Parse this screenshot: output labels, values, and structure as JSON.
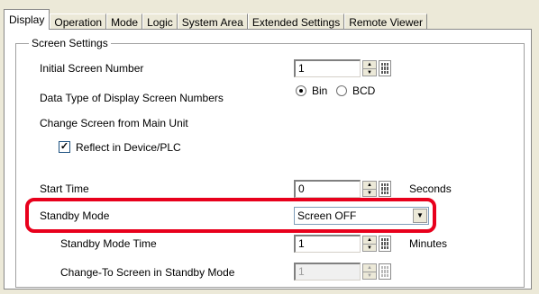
{
  "tabs": [
    {
      "label": "Display",
      "active": true
    },
    {
      "label": "Operation",
      "active": false
    },
    {
      "label": "Mode",
      "active": false
    },
    {
      "label": "Logic",
      "active": false
    },
    {
      "label": "System Area",
      "active": false
    },
    {
      "label": "Extended Settings",
      "active": false
    },
    {
      "label": "Remote Viewer",
      "active": false
    }
  ],
  "group": {
    "title": "Screen Settings"
  },
  "initial_screen": {
    "label": "Initial Screen Number",
    "value": "1"
  },
  "data_type": {
    "label": "Data Type of Display Screen Numbers",
    "options": [
      "Bin",
      "BCD"
    ],
    "selected": "Bin"
  },
  "change_screen": {
    "label": "Change Screen from Main Unit"
  },
  "reflect": {
    "label": "Reflect in Device/PLC",
    "checked": true,
    "check_glyph": "✓"
  },
  "start_time": {
    "label": "Start Time",
    "value": "0",
    "unit": "Seconds"
  },
  "standby_mode": {
    "label": "Standby Mode",
    "value": "Screen OFF"
  },
  "standby_time": {
    "label": "Standby Mode Time",
    "value": "1",
    "unit": "Minutes"
  },
  "standby_screen": {
    "label": "Change-To Screen in Standby Mode",
    "value": "1",
    "disabled": true
  },
  "colors": {
    "highlight": "#e8001c",
    "panel": "#ffffff",
    "window": "#ece9d8"
  },
  "icons": {
    "spin_up": "▲",
    "spin_down": "▼",
    "dropdown": "▼"
  }
}
